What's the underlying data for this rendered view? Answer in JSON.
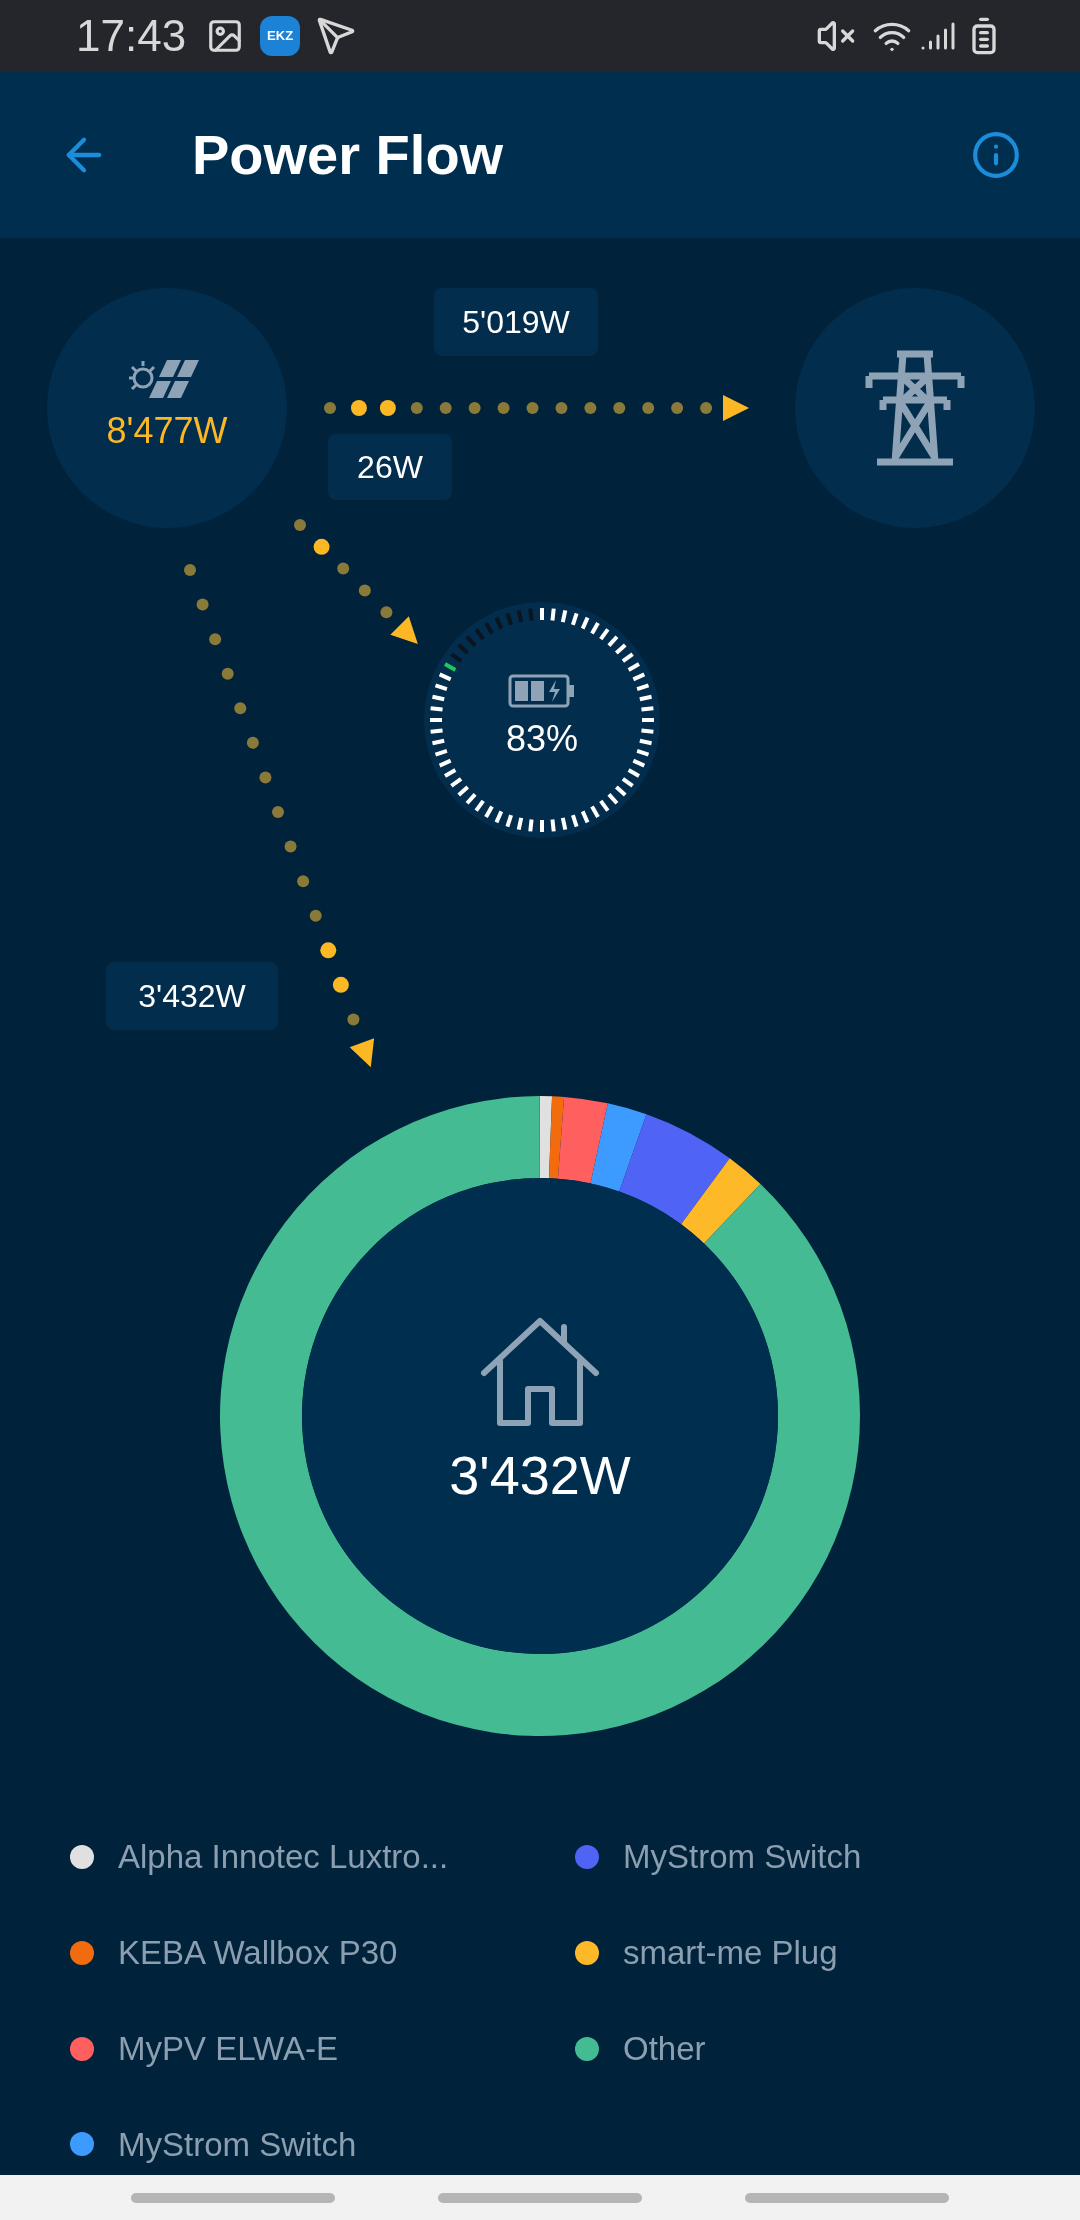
{
  "status_bar": {
    "time": "17:43",
    "app_badge": "EKZ"
  },
  "header": {
    "title": "Power Flow"
  },
  "flow": {
    "solar": {
      "value": "8'477W"
    },
    "to_grid": {
      "value": "5'019W"
    },
    "to_battery": {
      "value": "26W"
    },
    "battery": {
      "reading": "83%"
    },
    "to_home": {
      "value": "3'432W"
    }
  },
  "home": {
    "value": "3'432W"
  },
  "legend": [
    {
      "label": "Alpha Innotec Luxtro...",
      "color": "#e0e0e0"
    },
    {
      "label": "KEBA Wallbox P30",
      "color": "#f26b0f"
    },
    {
      "label": "MyPV ELWA-E",
      "color": "#ff5f5f"
    },
    {
      "label": "MyStrom Switch",
      "color": "#3d9bff"
    },
    {
      "label": "MyStrom Switch",
      "color": "#4f63f5"
    },
    {
      "label": "smart-me Plug",
      "color": "#fdb927"
    },
    {
      "label": "Other",
      "color": "#44bb92"
    }
  ]
}
